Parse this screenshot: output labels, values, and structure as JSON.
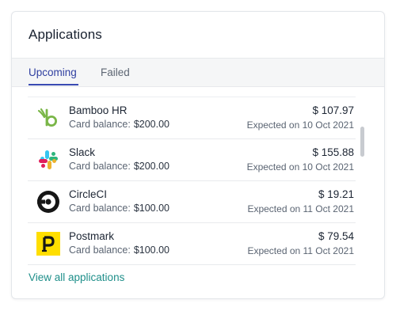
{
  "card": {
    "title": "Applications"
  },
  "tabs": [
    {
      "label": "Upcoming",
      "active": true
    },
    {
      "label": "Failed",
      "active": false
    }
  ],
  "colors": {
    "accent": "#3a4bb3",
    "link": "#1f8f8a"
  },
  "applications": [
    {
      "name": "Bamboo HR",
      "balance_label": "Card balance:",
      "balance": "$200.00",
      "amount": "$ 107.97",
      "expected": "Expected on 10 Oct 2021",
      "icon": "bamboohr-logo-icon"
    },
    {
      "name": "Slack",
      "balance_label": "Card balance:",
      "balance": "$200.00",
      "amount": "$ 155.88",
      "expected": "Expected on 10 Oct 2021",
      "icon": "slack-logo-icon"
    },
    {
      "name": "CircleCI",
      "balance_label": "Card balance:",
      "balance": "$100.00",
      "amount": "$ 19.21",
      "expected": "Expected on 11 Oct 2021",
      "icon": "circleci-logo-icon"
    },
    {
      "name": "Postmark",
      "balance_label": "Card balance:",
      "balance": "$100.00",
      "amount": "$ 79.54",
      "expected": "Expected on 11 Oct 2021",
      "icon": "postmark-logo-icon"
    }
  ],
  "footer": {
    "view_all_label": "View all applications"
  }
}
